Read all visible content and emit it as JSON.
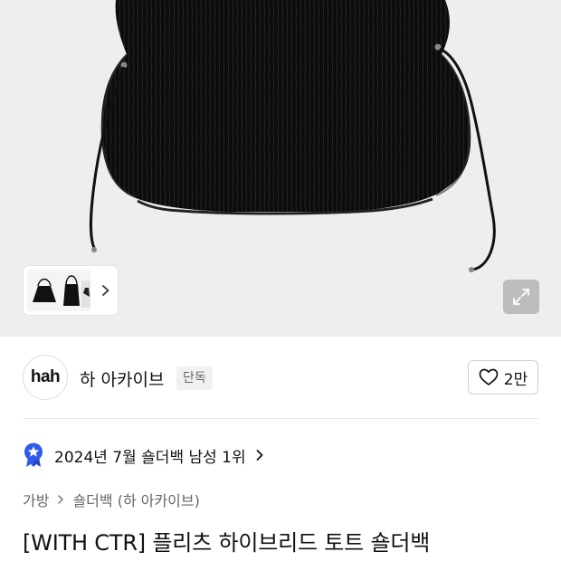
{
  "gallery": {
    "expand_icon": "expand-arrows-icon",
    "thumbnail_chevron_icon": "chevron-right-icon"
  },
  "brand": {
    "logo_text": "hah",
    "name": "하 아카이브",
    "badge": "단독",
    "like_icon": "heart-outline-icon",
    "like_count": "2만"
  },
  "ranking": {
    "icon": "star-medal-icon",
    "text": "2024년 7월 숄더백 남성 1위",
    "accent_color": "#2f5bea"
  },
  "breadcrumb": {
    "items": [
      "가방",
      "숄더백 (하 아카이브)"
    ]
  },
  "product": {
    "title": "[WITH CTR] 플리츠 하이브리드 토트 숄더백"
  }
}
